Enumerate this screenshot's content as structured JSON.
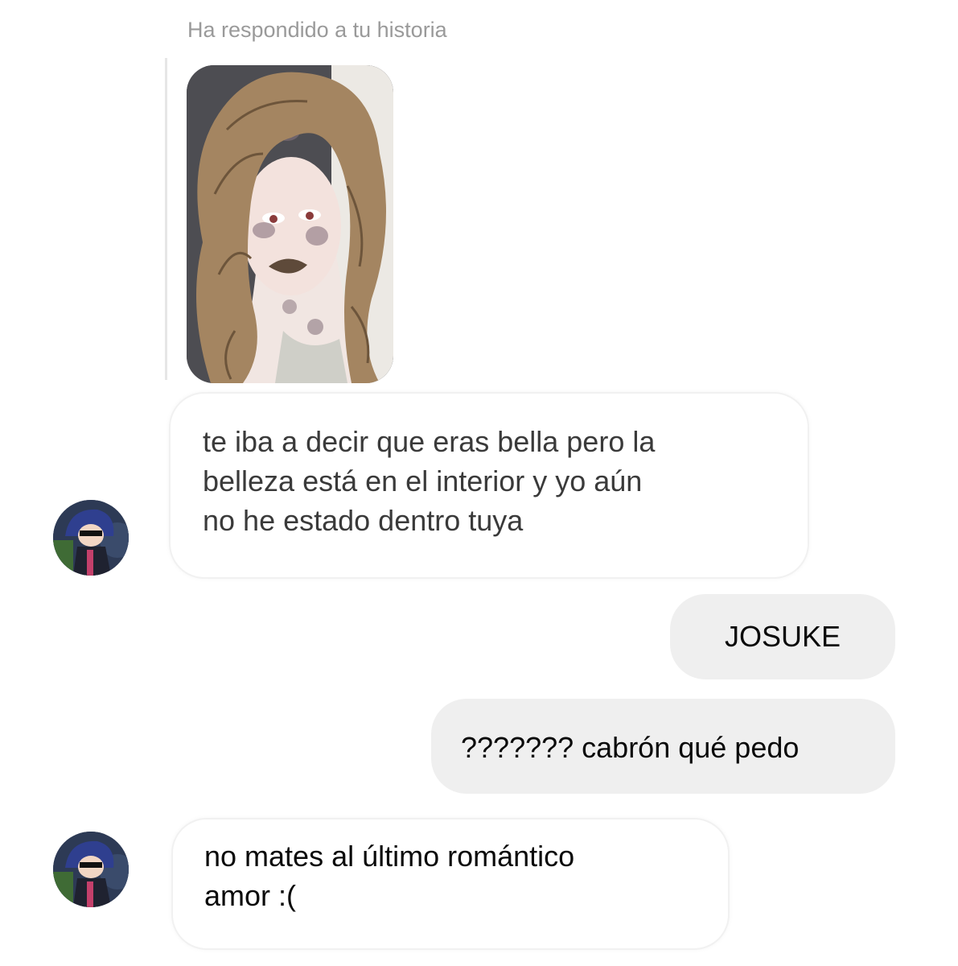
{
  "story_reply": {
    "caption": "Ha respondido a tu historia",
    "thumbnail": "drawing of a woman with long wavy brown hair"
  },
  "messages": [
    {
      "sender": "them",
      "lines": [
        "te iba a decir que eras bella pero la",
        "belleza está en el interior y yo aún",
        "no he estado dentro tuya"
      ]
    },
    {
      "sender": "me",
      "lines": [
        "JOSUKE"
      ]
    },
    {
      "sender": "me",
      "lines": [
        "??????? cabrón qué pedo"
      ]
    },
    {
      "sender": "them",
      "lines": [
        "no mates al último romántico",
        "amor :("
      ]
    }
  ],
  "colors": {
    "incoming_bubble": "#ffffff",
    "outgoing_bubble": "#efefef",
    "caption": "#9a9a9a"
  }
}
